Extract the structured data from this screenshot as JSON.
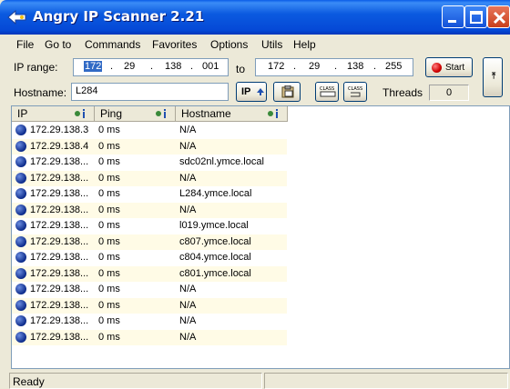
{
  "window": {
    "title": "Angry IP Scanner 2.21"
  },
  "menu": [
    "File",
    "Go to",
    "Commands",
    "Favorites",
    "Options",
    "Utils",
    "Help"
  ],
  "ip_range": {
    "label": "IP range:",
    "from": [
      "172",
      "29",
      "138",
      "001"
    ],
    "to_label": "to",
    "to": [
      "172",
      "29",
      "138",
      "255"
    ]
  },
  "hostname": {
    "label": "Hostname:",
    "value": "L284"
  },
  "buttons": {
    "start": "Start",
    "ip_up": "IP",
    "netmask": "⇤"
  },
  "threads": {
    "label": "Threads",
    "value": "0"
  },
  "columns": [
    "IP",
    "Ping",
    "Hostname"
  ],
  "rows": [
    {
      "ip": "172.29.138.3",
      "ping": "0 ms",
      "host": "N/A"
    },
    {
      "ip": "172.29.138.4",
      "ping": "0 ms",
      "host": "N/A"
    },
    {
      "ip": "172.29.138...",
      "ping": "0 ms",
      "host": "sdc02nl.ymce.local"
    },
    {
      "ip": "172.29.138...",
      "ping": "0 ms",
      "host": "N/A"
    },
    {
      "ip": "172.29.138...",
      "ping": "0 ms",
      "host": "L284.ymce.local"
    },
    {
      "ip": "172.29.138...",
      "ping": "0 ms",
      "host": "N/A"
    },
    {
      "ip": "172.29.138...",
      "ping": "0 ms",
      "host": "l019.ymce.local"
    },
    {
      "ip": "172.29.138...",
      "ping": "0 ms",
      "host": "c807.ymce.local"
    },
    {
      "ip": "172.29.138...",
      "ping": "0 ms",
      "host": "c804.ymce.local"
    },
    {
      "ip": "172.29.138...",
      "ping": "0 ms",
      "host": "c801.ymce.local"
    },
    {
      "ip": "172.29.138...",
      "ping": "0 ms",
      "host": "N/A"
    },
    {
      "ip": "172.29.138...",
      "ping": "0 ms",
      "host": "N/A"
    },
    {
      "ip": "172.29.138...",
      "ping": "0 ms",
      "host": "N/A"
    },
    {
      "ip": "172.29.138...",
      "ping": "0 ms",
      "host": "N/A"
    }
  ],
  "status": {
    "text": "Ready"
  }
}
